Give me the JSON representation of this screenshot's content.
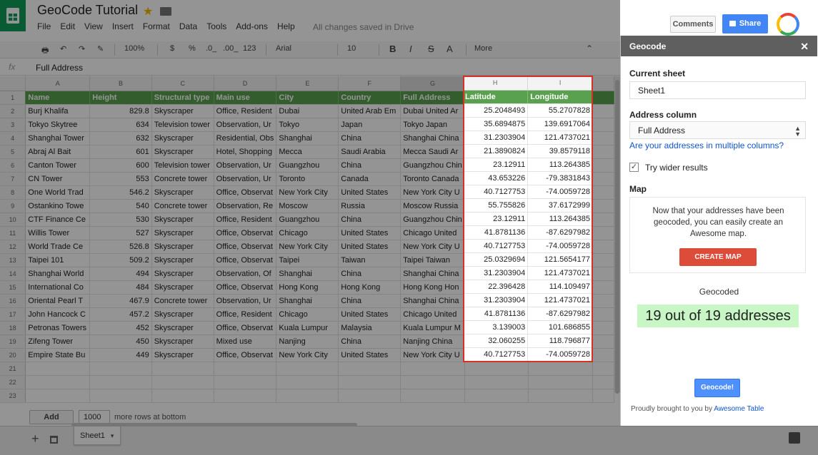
{
  "doc": {
    "title": "GeoCode Tutorial",
    "menu": [
      "File",
      "Edit",
      "View",
      "Insert",
      "Format",
      "Data",
      "Tools",
      "Add-ons",
      "Help"
    ],
    "saved_status": "All changes saved in Drive",
    "comments_label": "Comments",
    "share_label": "Share"
  },
  "toolbar": {
    "zoom": "100%",
    "currency": "$",
    "percent": "%",
    "dec_less": ".0_",
    "dec_more": ".00_",
    "format_more": "123",
    "font": "Arial",
    "font_size": "10",
    "bold": "B",
    "italic": "I",
    "strike": "S",
    "text_color": "A",
    "more": "More"
  },
  "formula_bar": {
    "fx": "fx",
    "value": "Full Address"
  },
  "grid": {
    "columns": [
      "A",
      "B",
      "C",
      "D",
      "E",
      "F",
      "G",
      "H",
      "I"
    ],
    "header": [
      "Name",
      "Height",
      "Structural type",
      "Main use",
      "City",
      "Country",
      "Full Address",
      "Latitude",
      "Longitude"
    ],
    "rows": [
      [
        "Burj Khalifa",
        "829.8",
        "Skyscraper",
        "Office, Resident",
        "Dubai",
        "United Arab Em",
        "Dubai  United Ar",
        "25.2048493",
        "55.2707828"
      ],
      [
        "Tokyo Skytree",
        "634",
        "Television tower",
        "Observation, Ur",
        "Tokyo",
        "Japan",
        "Tokyo  Japan",
        "35.6894875",
        "139.6917064"
      ],
      [
        "Shanghai Tower",
        "632",
        "Skyscraper",
        "Residential, Obs",
        "Shanghai",
        "China",
        "Shanghai  China",
        "31.2303904",
        "121.4737021"
      ],
      [
        "Abraj Al Bait",
        "601",
        "Skyscraper",
        "Hotel, Shopping",
        "Mecca",
        "Saudi Arabia",
        "Mecca  Saudi Ar",
        "21.3890824",
        "39.8579118"
      ],
      [
        "Canton Tower",
        "600",
        "Television tower",
        "Observation, Ur",
        "Guangzhou",
        "China",
        "Guangzhou  Chin",
        "23.12911",
        "113.264385"
      ],
      [
        "CN Tower",
        "553",
        "Concrete tower",
        "Observation, Ur",
        "Toronto",
        "Canada",
        "Toronto  Canada",
        "43.653226",
        "-79.3831843"
      ],
      [
        "One World Trad",
        "546.2",
        "Skyscraper",
        "Office, Observat",
        "New York City",
        "United States",
        "New York City  U",
        "40.7127753",
        "-74.0059728"
      ],
      [
        "Ostankino Towe",
        "540",
        "Concrete tower",
        "Observation, Re",
        "Moscow",
        "Russia",
        "Moscow  Russia",
        "55.755826",
        "37.6172999"
      ],
      [
        "CTF Finance Ce",
        "530",
        "Skyscraper",
        "Office, Resident",
        "Guangzhou",
        "China",
        "Guangzhou  Chin",
        "23.12911",
        "113.264385"
      ],
      [
        "Willis Tower",
        "527",
        "Skyscraper",
        "Office, Observat",
        "Chicago",
        "United States",
        "Chicago  United",
        "41.8781136",
        "-87.6297982"
      ],
      [
        "World Trade Ce",
        "526.8",
        "Skyscraper",
        "Office, Observat",
        "New York City",
        "United States",
        "New York City  U",
        "40.7127753",
        "-74.0059728"
      ],
      [
        "Taipei 101",
        "509.2",
        "Skyscraper",
        "Office, Observat",
        "Taipei",
        "Taiwan",
        "Taipei  Taiwan",
        "25.0329694",
        "121.5654177"
      ],
      [
        "Shanghai World",
        "494",
        "Skyscraper",
        "Observation, Of",
        "Shanghai",
        "China",
        "Shanghai  China",
        "31.2303904",
        "121.4737021"
      ],
      [
        "International Co",
        "484",
        "Skyscraper",
        "Office, Observat",
        "Hong Kong",
        "Hong Kong",
        "Hong Kong  Hon",
        "22.396428",
        "114.109497"
      ],
      [
        "Oriental Pearl T",
        "467.9",
        "Concrete tower",
        "Observation, Ur",
        "Shanghai",
        "China",
        "Shanghai  China",
        "31.2303904",
        "121.4737021"
      ],
      [
        "John Hancock C",
        "457.2",
        "Skyscraper",
        "Office, Resident",
        "Chicago",
        "United States",
        "Chicago  United",
        "41.8781136",
        "-87.6297982"
      ],
      [
        "Petronas Towers",
        "452",
        "Skyscraper",
        "Office, Observat",
        "Kuala Lumpur",
        "Malaysia",
        "Kuala Lumpur  M",
        "3.139003",
        "101.686855"
      ],
      [
        "Zifeng Tower",
        "450",
        "Skyscraper",
        "Mixed use",
        "Nanjing",
        "China",
        "Nanjing  China",
        "32.060255",
        "118.796877"
      ],
      [
        "Empire State Bu",
        "449",
        "Skyscraper",
        "Office, Observat",
        "New York City",
        "United States",
        "New York City  U",
        "40.7127753",
        "-74.0059728"
      ]
    ],
    "empty_rows": [
      "21",
      "22",
      "23"
    ]
  },
  "bottom": {
    "add_label": "Add",
    "rows_value": "1000",
    "more_rows_text": "more rows at bottom",
    "sheet_tab": "Sheet1"
  },
  "sidebar": {
    "title": "Geocode",
    "current_sheet_label": "Current sheet",
    "current_sheet_value": "Sheet1",
    "address_column_label": "Address column",
    "address_column_value": "Full Address",
    "multiple_columns_link": "Are your addresses in multiple columns?",
    "wider_results_label": "Try wider results",
    "wider_results_checked": true,
    "map_label": "Map",
    "map_message": "Now that your addresses have been geocoded, you can easily create an Awesome map.",
    "create_map_label": "CREATE MAP",
    "geocoded_label": "Geocoded",
    "result_text": "19 out of 19 addresses",
    "geocode_button": "Geocode!",
    "footer_text": "Proudly brought to you by",
    "footer_link": "Awesome Table"
  },
  "colors": {
    "header_green": "#59a14f",
    "share_blue": "#4285f4",
    "create_map_red": "#dd4b39",
    "result_bg": "#c8f7c5",
    "highlight_border": "#d93025"
  }
}
